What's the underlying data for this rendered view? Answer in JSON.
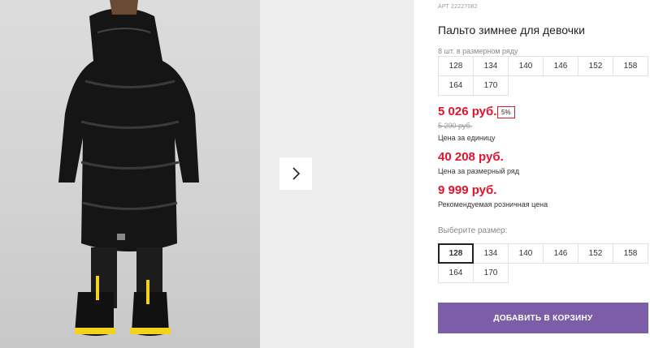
{
  "product": {
    "article": "АРТ 22227082",
    "title": "Пальто зимнее для девочки",
    "row_info": "8 шт. в размерном ряду"
  },
  "row_sizes": [
    "128",
    "134",
    "140",
    "146",
    "152",
    "158",
    "164",
    "170"
  ],
  "prices": {
    "unit_price": "5 026 руб.",
    "discount": "5%",
    "old_price": "5 290 руб.",
    "unit_price_label": "Цена за единицу",
    "row_price": "40 208 руб.",
    "row_price_label": "Цена за размерный ряд",
    "retail_price": "9 999 руб.",
    "retail_price_label": "Рекомендуемая розничная цена"
  },
  "size_picker": {
    "label": "Выберите размер:",
    "selected": "128",
    "sizes": [
      "128",
      "134",
      "140",
      "146",
      "152",
      "158",
      "164",
      "170"
    ]
  },
  "cart": {
    "add_label": "ДОБАВИТЬ В КОРЗИНУ"
  },
  "colors": {
    "price_red": "#e2132c",
    "button_purple": "#7b5ea7",
    "text_dark": "#222222"
  },
  "icons": {
    "next": "chevron-right-icon"
  }
}
